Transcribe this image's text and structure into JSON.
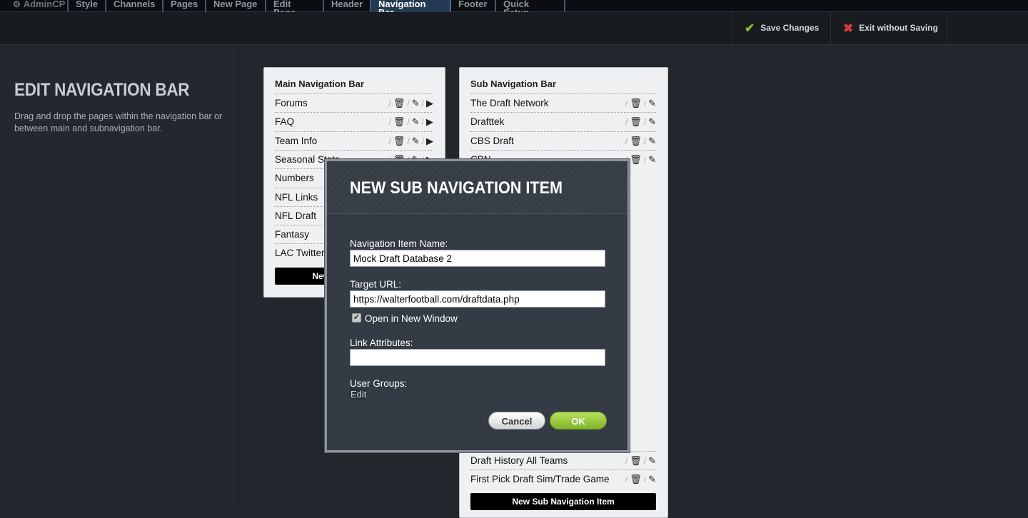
{
  "tabs": [
    {
      "label": "AdminCP",
      "icon": "gear-icon"
    },
    {
      "label": "Style"
    },
    {
      "label": "Channels"
    },
    {
      "label": "Pages"
    },
    {
      "label": "New Page"
    },
    {
      "label": "Edit Page"
    },
    {
      "label": "Header"
    },
    {
      "label": "Navigation Bar",
      "active": true
    },
    {
      "label": "Footer"
    },
    {
      "label": "Quick Setup"
    }
  ],
  "actions": {
    "save_label": "Save Changes",
    "exit_label": "Exit without Saving"
  },
  "left": {
    "title": "EDIT NAVIGATION BAR",
    "description": "Drag and drop the pages within the navigation bar or between main and subnavigation bar."
  },
  "main_nav": {
    "title": "Main Navigation Bar",
    "items": [
      "Forums",
      "FAQ",
      "Team Info",
      "Seasonal Stats",
      "Numbers",
      "NFL Links",
      "NFL Draft",
      "Fantasy",
      "LAC Twitter"
    ],
    "new_button": "New Navigation Item"
  },
  "sub_nav": {
    "title": "Sub Navigation Bar",
    "items_top": [
      "The Draft Network",
      "Drafttek",
      "CBS Draft",
      "CBN"
    ],
    "items_bottom": [
      "Draft History All Teams",
      "First Pick Draft Sim/Trade Game"
    ],
    "new_button": "New Sub Navigation Item"
  },
  "modal": {
    "title": "NEW SUB NAVIGATION ITEM",
    "name_label": "Navigation Item Name:",
    "name_value": "Mock Draft Database 2",
    "url_label": "Target URL:",
    "url_value": "https://walterfootball.com/draftdata.php",
    "new_window_label": "Open in New Window",
    "new_window_checked": true,
    "attrs_label": "Link Attributes:",
    "attrs_value": "",
    "groups_label": "User Groups:",
    "groups_edit": "Edit",
    "cancel_label": "Cancel",
    "ok_label": "OK"
  },
  "colors": {
    "accent_green": "#7fc128",
    "danger_red": "#d43a3a",
    "active_tab": "#243a52"
  }
}
